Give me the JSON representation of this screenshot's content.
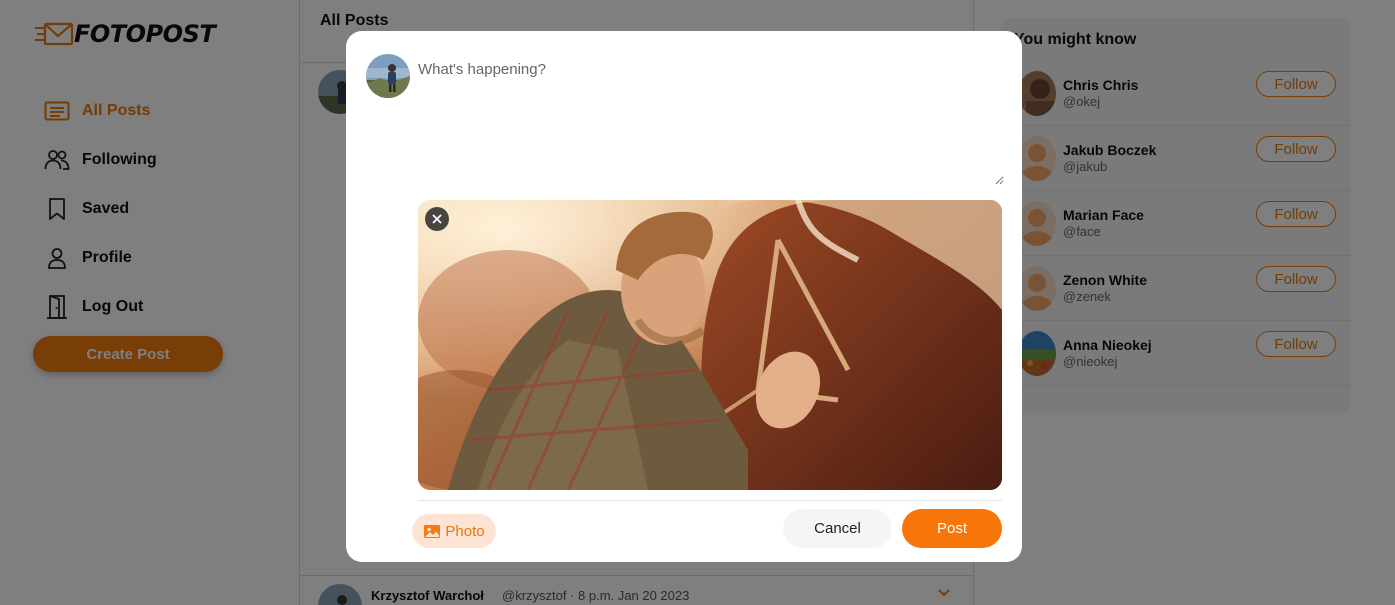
{
  "brand": {
    "logo_text": "FOTOPOST",
    "accent": "#f37b0f"
  },
  "sidebar": {
    "items": [
      {
        "label": "All Posts",
        "icon": "list-icon",
        "active": true
      },
      {
        "label": "Following",
        "icon": "users-icon",
        "active": false
      },
      {
        "label": "Saved",
        "icon": "bookmark-icon",
        "active": false
      },
      {
        "label": "Profile",
        "icon": "user-icon",
        "active": false
      },
      {
        "label": "Log Out",
        "icon": "door-icon",
        "active": false
      }
    ],
    "create_post_label": "Create Post"
  },
  "feed": {
    "title": "All Posts",
    "post": {
      "author": "Krzysztof Warchoł",
      "meta": "@krzysztof · 8 p.m. Jan 20 2023"
    }
  },
  "suggestions": {
    "title": "You might know",
    "follow_label": "Follow",
    "people": [
      {
        "name": "Chris Chris",
        "handle": "@okej"
      },
      {
        "name": "Jakub Boczek",
        "handle": "@jakub"
      },
      {
        "name": "Marian Face",
        "handle": "@face"
      },
      {
        "name": "Zenon White",
        "handle": "@zenek"
      },
      {
        "name": "Anna Nieokej",
        "handle": "@nieokej"
      }
    ]
  },
  "modal": {
    "placeholder": "What's happening?",
    "photo_label": "Photo",
    "cancel_label": "Cancel",
    "post_label": "Post"
  }
}
